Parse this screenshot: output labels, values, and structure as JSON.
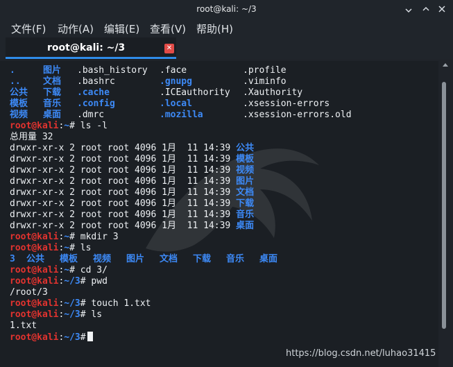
{
  "window": {
    "title": "root@kali: ~/3",
    "controls": {
      "minimize": "—",
      "maximize": "□",
      "close": "✕"
    }
  },
  "menu": [
    "文件(F)",
    "动作(A)",
    "编辑(E)",
    "查看(V)",
    "帮助(H)"
  ],
  "tab": {
    "label": "root@kali: ~/3",
    "close_icon": "close-icon"
  },
  "watermark_text": "https://blog.csdn.net/luhao31415",
  "prompt": {
    "user_host": "root@kali",
    "sep": ":",
    "path_home": "~",
    "path_3": "~/3",
    "suffix": "#"
  },
  "ls_all": [
    [
      ".",
      "图片",
      ".bash_history",
      ".face",
      ".profile"
    ],
    [
      "..",
      "文档",
      ".bashrc",
      ".gnupg",
      ".viminfo"
    ],
    [
      "公共",
      "下载",
      ".cache",
      ".ICEauthority",
      ".Xauthority"
    ],
    [
      "模板",
      "音乐",
      ".config",
      ".local",
      ".xsession-errors"
    ],
    [
      "视频",
      "桌面",
      ".dmrc",
      ".mozilla",
      ".xsession-errors.old"
    ]
  ],
  "commands": {
    "ls_l": " ls -l",
    "mkdir": " mkdir 3",
    "ls": " ls",
    "cd": " cd 3/",
    "pwd": " pwd",
    "touch": " touch 1.txt",
    "ls2": " ls"
  },
  "total": "总用量 32",
  "ls_l_rows": [
    {
      "perm": "drwxr-xr-x 2 root root 4096 1月  11 14:39",
      "name": "公共"
    },
    {
      "perm": "drwxr-xr-x 2 root root 4096 1月  11 14:39",
      "name": "模板"
    },
    {
      "perm": "drwxr-xr-x 2 root root 4096 1月  11 14:39",
      "name": "视频"
    },
    {
      "perm": "drwxr-xr-x 2 root root 4096 1月  11 14:39",
      "name": "图片"
    },
    {
      "perm": "drwxr-xr-x 2 root root 4096 1月  11 14:39",
      "name": "文档"
    },
    {
      "perm": "drwxr-xr-x 2 root root 4096 1月  11 14:39",
      "name": "下载"
    },
    {
      "perm": "drwxr-xr-x 2 root root 4096 1月  11 14:39",
      "name": "音乐"
    },
    {
      "perm": "drwxr-xr-x 2 root root 4096 1月  11 14:39",
      "name": "桌面"
    }
  ],
  "ls_output": [
    "3",
    "公共",
    "模板",
    "视频",
    "图片",
    "文档",
    "下载",
    "音乐",
    "桌面"
  ],
  "pwd_output": "/root/3",
  "ls2_output": "1.txt",
  "colors": {
    "accent": "#2f8ce8",
    "dir_blue": "#3d8af7",
    "prompt_red": "#e2332f",
    "tab_close": "#e24b47"
  }
}
